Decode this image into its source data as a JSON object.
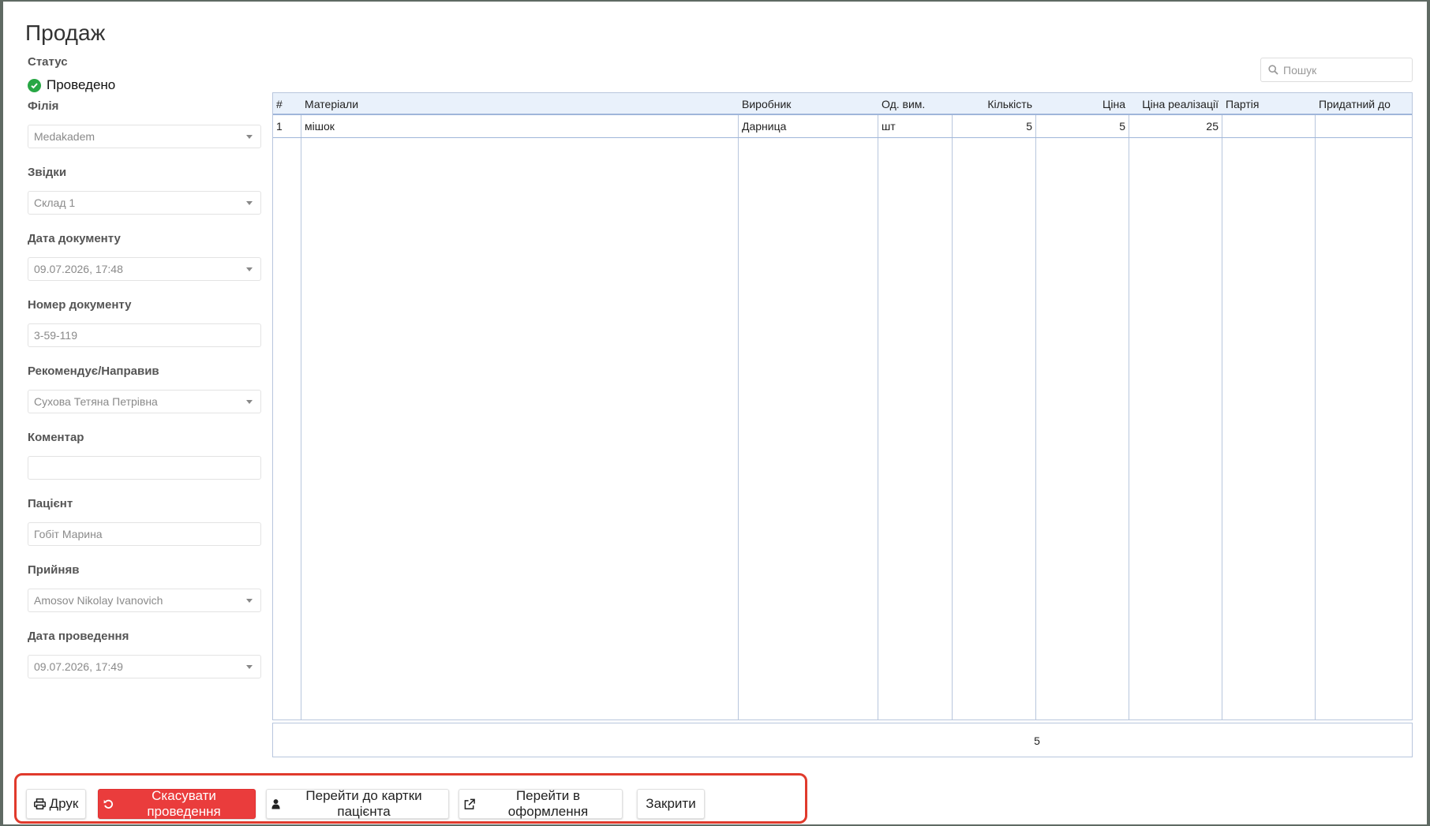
{
  "page": {
    "title": "Продаж"
  },
  "form": {
    "status_label": "Статус",
    "status_value": "Проведено",
    "branch": {
      "label": "Філія",
      "value": "Medakadem"
    },
    "from": {
      "label": "Звідки",
      "value": "Склад 1"
    },
    "doc_date": {
      "label": "Дата документу",
      "value": "09.07.2026, 17:48"
    },
    "doc_number": {
      "label": "Номер документу",
      "value": "3-59-119"
    },
    "referrer": {
      "label": "Рекомендує/Направив",
      "value": "Сухова Тетяна Петрівна"
    },
    "comment": {
      "label": "Коментар",
      "value": ""
    },
    "patient": {
      "label": "Пацієнт",
      "value": "Гобіт Марина"
    },
    "accepted": {
      "label": "Прийняв",
      "value": "Amosov Nikolay Ivanovich"
    },
    "post_date": {
      "label": "Дата проведення",
      "value": "09.07.2026, 17:49"
    }
  },
  "search": {
    "placeholder": "Пошук"
  },
  "table": {
    "columns": [
      "#",
      "Матеріали",
      "Виробник",
      "Од. вим.",
      "Кількість",
      "Ціна",
      "Ціна реалізації",
      "Партія",
      "Придатний до"
    ],
    "rows": [
      {
        "num": "1",
        "material": "мішок",
        "producer": "Дарница",
        "unit": "шт",
        "qty": "5",
        "price": "5",
        "sale_price": "25",
        "batch": "",
        "expiry": ""
      }
    ],
    "footer_total": "5"
  },
  "buttons": {
    "print": "Друк",
    "cancel_posting": "Скасувати проведення",
    "patient_card": "Перейти до картки пацієнта",
    "to_registration": "Перейти в оформлення",
    "close": "Закрити"
  },
  "colors": {
    "accent_red": "#ea3c3c",
    "status_green": "#28a745",
    "grid_border": "#b8c6dd",
    "header_bg": "#e9f1fb"
  }
}
